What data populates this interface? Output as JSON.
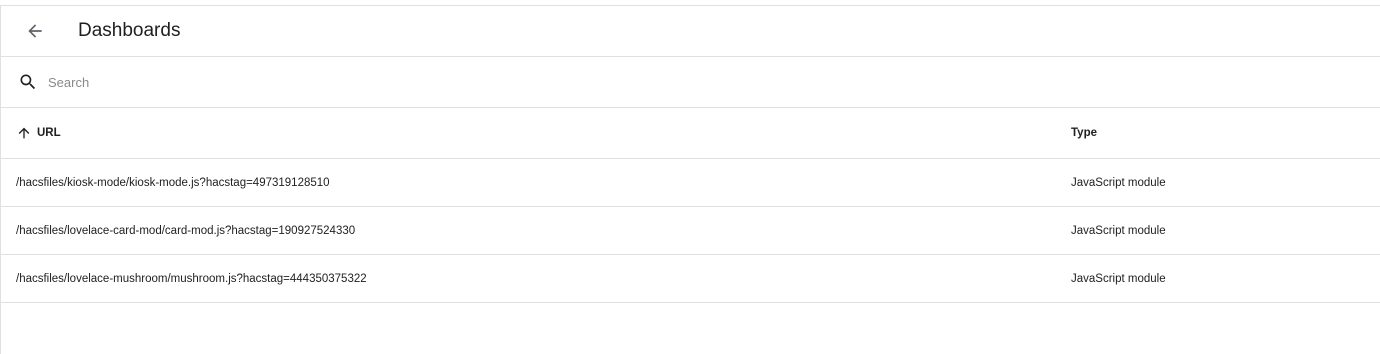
{
  "header": {
    "title": "Dashboards"
  },
  "search": {
    "placeholder": "Search"
  },
  "table": {
    "columns": {
      "url": "URL",
      "type": "Type"
    },
    "rows": [
      {
        "url": "/hacsfiles/kiosk-mode/kiosk-mode.js?hacstag=497319128510",
        "type": "JavaScript module"
      },
      {
        "url": "/hacsfiles/lovelace-card-mod/card-mod.js?hacstag=190927524330",
        "type": "JavaScript module"
      },
      {
        "url": "/hacsfiles/lovelace-mushroom/mushroom.js?hacstag=444350375322",
        "type": "JavaScript module"
      }
    ]
  },
  "icons": {
    "back": "arrow-left-icon",
    "search": "magnify-icon",
    "sort": "arrow-up-icon"
  }
}
